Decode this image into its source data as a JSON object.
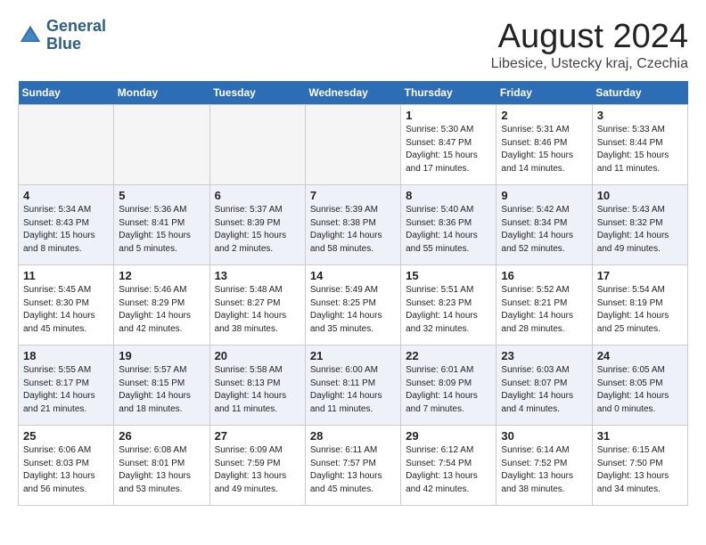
{
  "header": {
    "logo_line1": "General",
    "logo_line2": "Blue",
    "month": "August 2024",
    "location": "Libesice, Ustecky kraj, Czechia"
  },
  "weekdays": [
    "Sunday",
    "Monday",
    "Tuesday",
    "Wednesday",
    "Thursday",
    "Friday",
    "Saturday"
  ],
  "weeks": [
    [
      {
        "day": "",
        "info": ""
      },
      {
        "day": "",
        "info": ""
      },
      {
        "day": "",
        "info": ""
      },
      {
        "day": "",
        "info": ""
      },
      {
        "day": "1",
        "info": "Sunrise: 5:30 AM\nSunset: 8:47 PM\nDaylight: 15 hours\nand 17 minutes."
      },
      {
        "day": "2",
        "info": "Sunrise: 5:31 AM\nSunset: 8:46 PM\nDaylight: 15 hours\nand 14 minutes."
      },
      {
        "day": "3",
        "info": "Sunrise: 5:33 AM\nSunset: 8:44 PM\nDaylight: 15 hours\nand 11 minutes."
      }
    ],
    [
      {
        "day": "4",
        "info": "Sunrise: 5:34 AM\nSunset: 8:43 PM\nDaylight: 15 hours\nand 8 minutes."
      },
      {
        "day": "5",
        "info": "Sunrise: 5:36 AM\nSunset: 8:41 PM\nDaylight: 15 hours\nand 5 minutes."
      },
      {
        "day": "6",
        "info": "Sunrise: 5:37 AM\nSunset: 8:39 PM\nDaylight: 15 hours\nand 2 minutes."
      },
      {
        "day": "7",
        "info": "Sunrise: 5:39 AM\nSunset: 8:38 PM\nDaylight: 14 hours\nand 58 minutes."
      },
      {
        "day": "8",
        "info": "Sunrise: 5:40 AM\nSunset: 8:36 PM\nDaylight: 14 hours\nand 55 minutes."
      },
      {
        "day": "9",
        "info": "Sunrise: 5:42 AM\nSunset: 8:34 PM\nDaylight: 14 hours\nand 52 minutes."
      },
      {
        "day": "10",
        "info": "Sunrise: 5:43 AM\nSunset: 8:32 PM\nDaylight: 14 hours\nand 49 minutes."
      }
    ],
    [
      {
        "day": "11",
        "info": "Sunrise: 5:45 AM\nSunset: 8:30 PM\nDaylight: 14 hours\nand 45 minutes."
      },
      {
        "day": "12",
        "info": "Sunrise: 5:46 AM\nSunset: 8:29 PM\nDaylight: 14 hours\nand 42 minutes."
      },
      {
        "day": "13",
        "info": "Sunrise: 5:48 AM\nSunset: 8:27 PM\nDaylight: 14 hours\nand 38 minutes."
      },
      {
        "day": "14",
        "info": "Sunrise: 5:49 AM\nSunset: 8:25 PM\nDaylight: 14 hours\nand 35 minutes."
      },
      {
        "day": "15",
        "info": "Sunrise: 5:51 AM\nSunset: 8:23 PM\nDaylight: 14 hours\nand 32 minutes."
      },
      {
        "day": "16",
        "info": "Sunrise: 5:52 AM\nSunset: 8:21 PM\nDaylight: 14 hours\nand 28 minutes."
      },
      {
        "day": "17",
        "info": "Sunrise: 5:54 AM\nSunset: 8:19 PM\nDaylight: 14 hours\nand 25 minutes."
      }
    ],
    [
      {
        "day": "18",
        "info": "Sunrise: 5:55 AM\nSunset: 8:17 PM\nDaylight: 14 hours\nand 21 minutes."
      },
      {
        "day": "19",
        "info": "Sunrise: 5:57 AM\nSunset: 8:15 PM\nDaylight: 14 hours\nand 18 minutes."
      },
      {
        "day": "20",
        "info": "Sunrise: 5:58 AM\nSunset: 8:13 PM\nDaylight: 14 hours\nand 11 minutes."
      },
      {
        "day": "21",
        "info": "Sunrise: 6:00 AM\nSunset: 8:11 PM\nDaylight: 14 hours\nand 11 minutes."
      },
      {
        "day": "22",
        "info": "Sunrise: 6:01 AM\nSunset: 8:09 PM\nDaylight: 14 hours\nand 7 minutes."
      },
      {
        "day": "23",
        "info": "Sunrise: 6:03 AM\nSunset: 8:07 PM\nDaylight: 14 hours\nand 4 minutes."
      },
      {
        "day": "24",
        "info": "Sunrise: 6:05 AM\nSunset: 8:05 PM\nDaylight: 14 hours\nand 0 minutes."
      }
    ],
    [
      {
        "day": "25",
        "info": "Sunrise: 6:06 AM\nSunset: 8:03 PM\nDaylight: 13 hours\nand 56 minutes."
      },
      {
        "day": "26",
        "info": "Sunrise: 6:08 AM\nSunset: 8:01 PM\nDaylight: 13 hours\nand 53 minutes."
      },
      {
        "day": "27",
        "info": "Sunrise: 6:09 AM\nSunset: 7:59 PM\nDaylight: 13 hours\nand 49 minutes."
      },
      {
        "day": "28",
        "info": "Sunrise: 6:11 AM\nSunset: 7:57 PM\nDaylight: 13 hours\nand 45 minutes."
      },
      {
        "day": "29",
        "info": "Sunrise: 6:12 AM\nSunset: 7:54 PM\nDaylight: 13 hours\nand 42 minutes."
      },
      {
        "day": "30",
        "info": "Sunrise: 6:14 AM\nSunset: 7:52 PM\nDaylight: 13 hours\nand 38 minutes."
      },
      {
        "day": "31",
        "info": "Sunrise: 6:15 AM\nSunset: 7:50 PM\nDaylight: 13 hours\nand 34 minutes."
      }
    ]
  ]
}
